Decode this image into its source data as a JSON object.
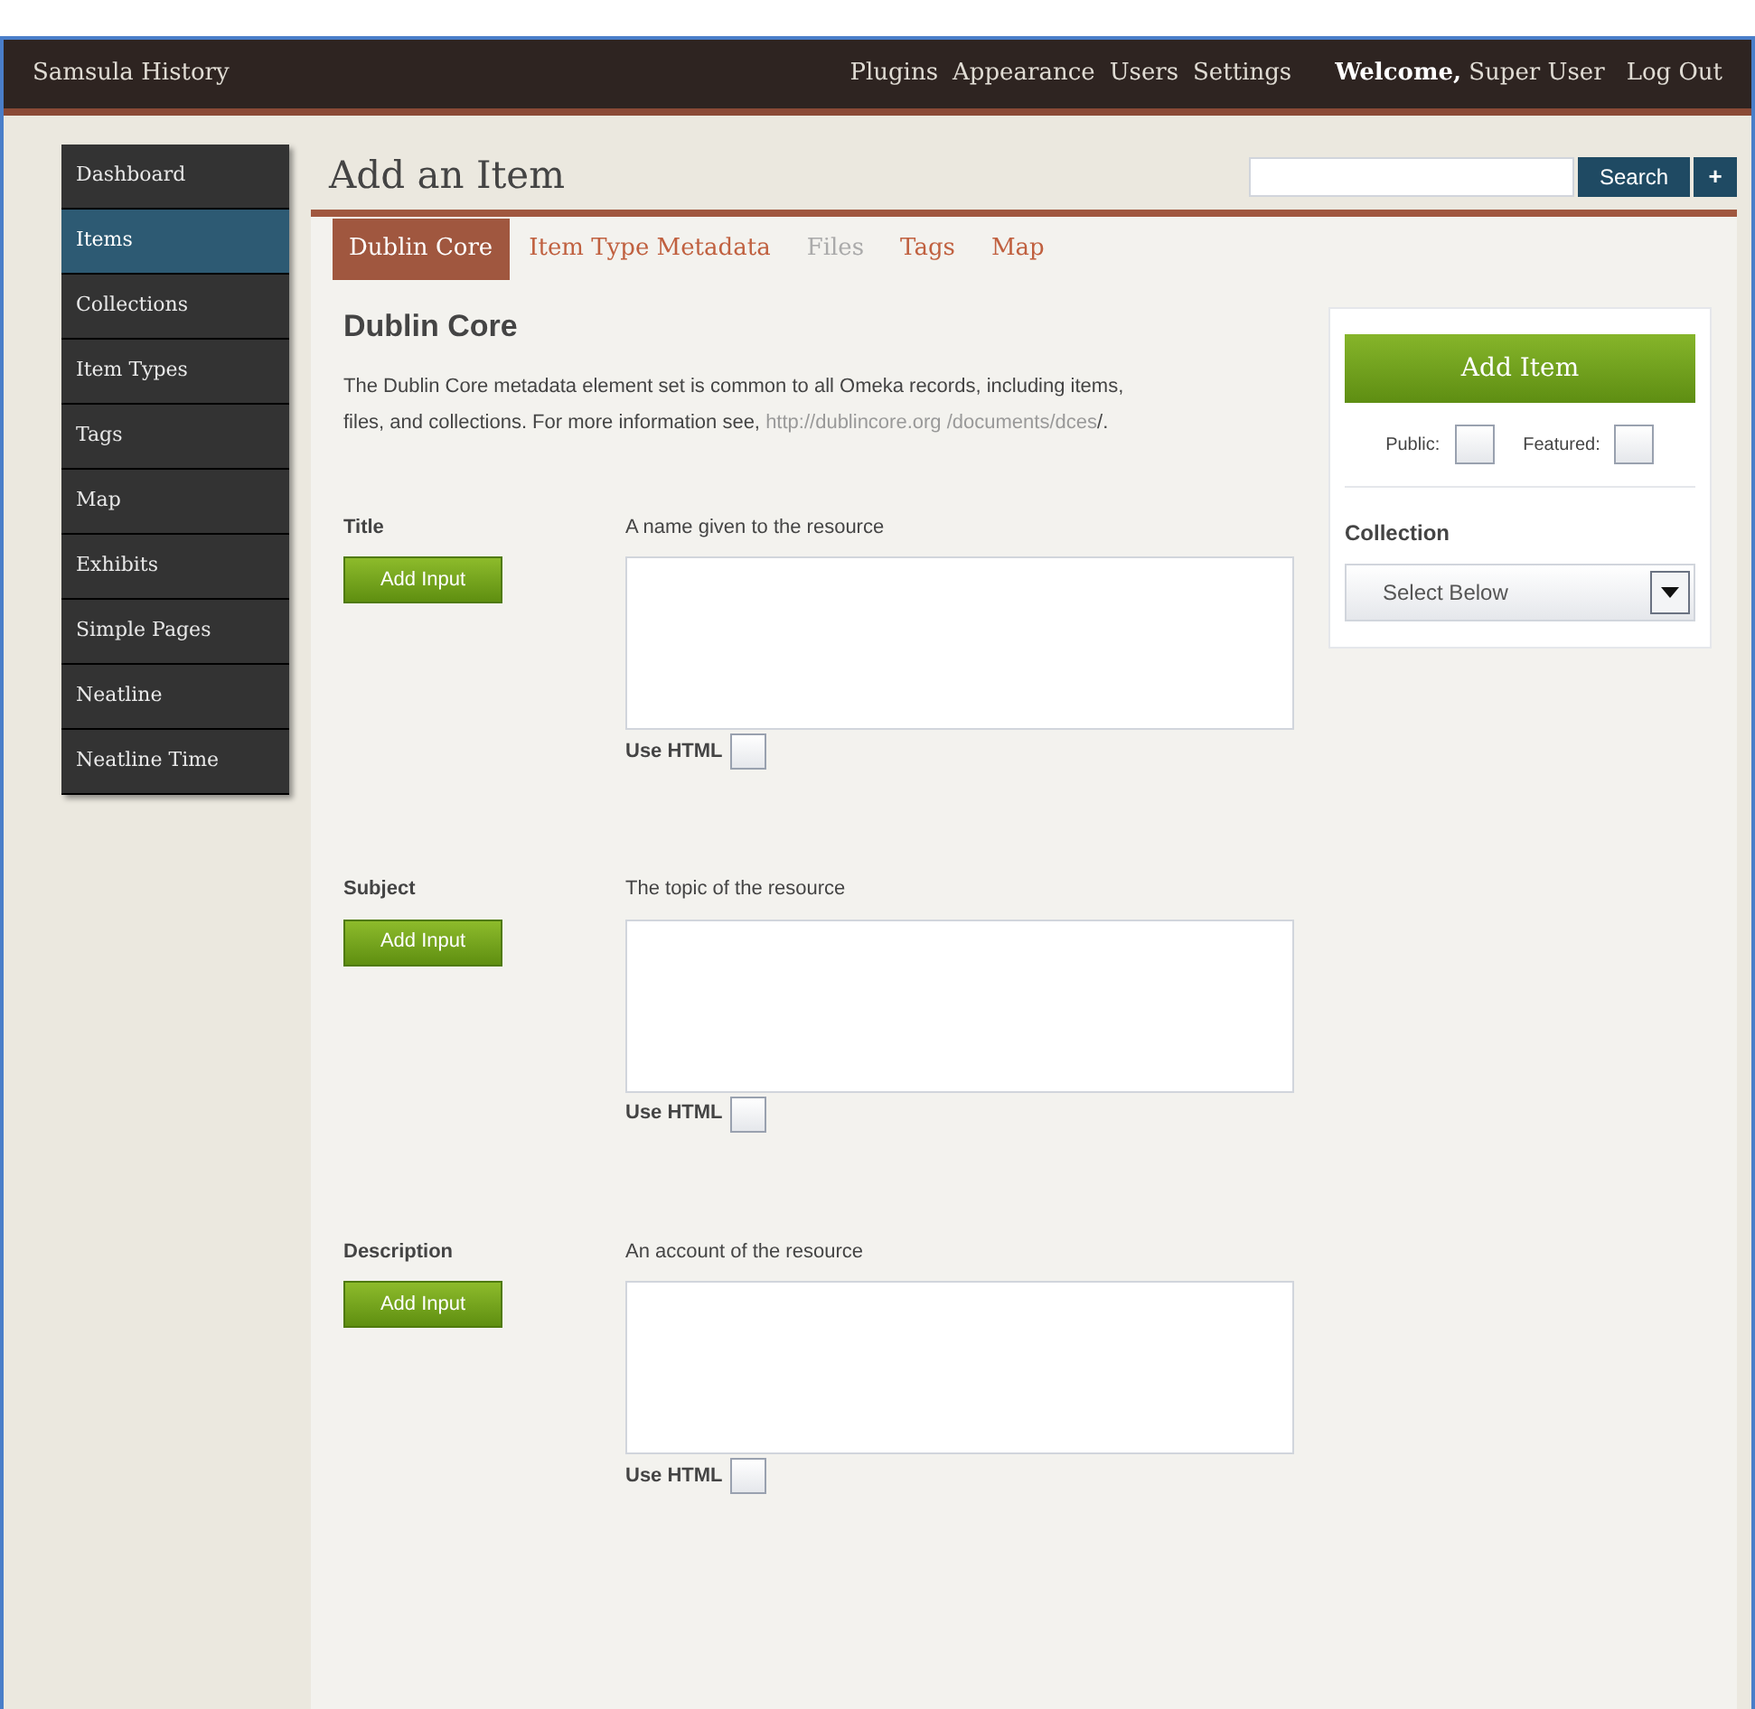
{
  "site_title": "Samsula History",
  "top_nav": [
    "Plugins",
    "Appearance",
    "Users",
    "Settings"
  ],
  "welcome": {
    "label": "Welcome,",
    "user": "Super User"
  },
  "logout": "Log Out",
  "sidebar": {
    "items": [
      {
        "label": "Dashboard",
        "selected": false
      },
      {
        "label": "Items",
        "selected": true
      },
      {
        "label": "Collections",
        "selected": false
      },
      {
        "label": "Item Types",
        "selected": false
      },
      {
        "label": "Tags",
        "selected": false
      },
      {
        "label": "Map",
        "selected": false
      },
      {
        "label": "Exhibits",
        "selected": false
      },
      {
        "label": "Simple Pages",
        "selected": false
      },
      {
        "label": "Neatline",
        "selected": false
      },
      {
        "label": "Neatline Time",
        "selected": false
      }
    ]
  },
  "page_title": "Add an Item",
  "search": {
    "button": "Search",
    "add": "+"
  },
  "tabs": [
    {
      "label": "Dublin Core",
      "selected": true,
      "disabled": false
    },
    {
      "label": "Item Type Metadata",
      "selected": false,
      "disabled": false
    },
    {
      "label": "Files",
      "selected": false,
      "disabled": true
    },
    {
      "label": "Tags",
      "selected": false,
      "disabled": false
    },
    {
      "label": "Map",
      "selected": false,
      "disabled": false
    }
  ],
  "section": {
    "title": "Dublin Core",
    "description": "The Dublin Core metadata element set is common to all Omeka records, including items, files, and collections. For more information see,",
    "link": "http://dublincore.org /documents/dces",
    "after": "/."
  },
  "fields": [
    {
      "label": "Title",
      "hint": "A name given to the resource",
      "button": "Add Input",
      "html_label": "Use HTML",
      "checked": false
    },
    {
      "label": "Subject",
      "hint": "The topic of the resource",
      "button": "Add Input",
      "html_label": "Use HTML",
      "checked": false
    },
    {
      "label": "Description",
      "hint": "An account of the resource",
      "button": "Add Input",
      "html_label": "Use HTML",
      "checked": false
    }
  ],
  "panel": {
    "button": "Add Item",
    "public": {
      "label": "Public:",
      "checked": false
    },
    "featured": {
      "label": "Featured:",
      "checked": false
    },
    "collection_label": "Collection",
    "collection_value": "Select Below"
  }
}
